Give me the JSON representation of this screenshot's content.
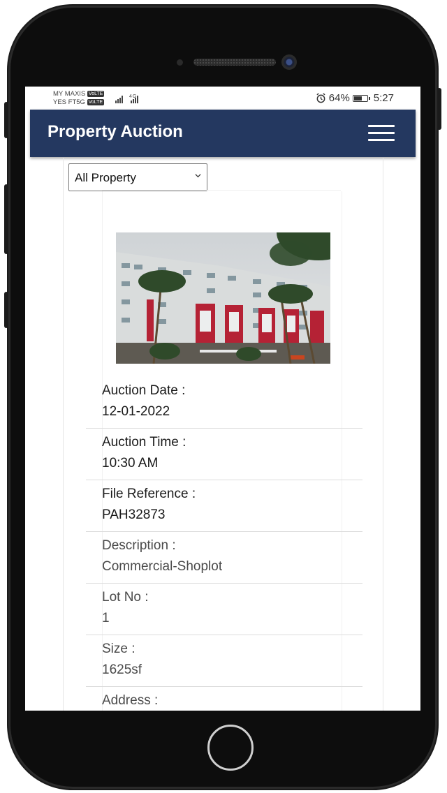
{
  "status_bar": {
    "carrier_line1": "MY MAXIS",
    "carrier_line2": "YES FT5G",
    "volte_badge": "VoLTE",
    "network": "4G",
    "battery_percent": "64%",
    "battery_level": 0.64,
    "time": "5:27",
    "icons": [
      "alarm-icon",
      "battery-icon",
      "signal-icon"
    ]
  },
  "app_bar": {
    "title": "Property Auction",
    "menu_icon": "hamburger-menu-icon",
    "background_color": "#243860"
  },
  "filter": {
    "selected": "All Property"
  },
  "property": {
    "fields": [
      {
        "label": "Auction Date :",
        "value": "12-01-2022"
      },
      {
        "label": "Auction Time :",
        "value": "10:30 AM"
      },
      {
        "label": "File Reference :",
        "value": "PAH32873"
      },
      {
        "label": "Description :",
        "value": "Commercial-Shoplot"
      },
      {
        "label": "Lot No :",
        "value": "1"
      },
      {
        "label": "Size :",
        "value": "1625sf"
      },
      {
        "label": "Address :",
        "value": ""
      }
    ]
  }
}
